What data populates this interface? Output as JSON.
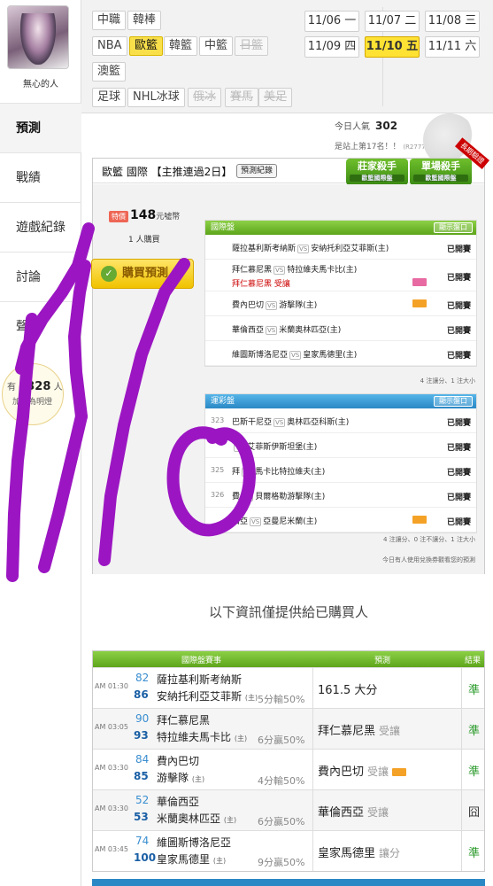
{
  "sidebar": {
    "username": "無心的人",
    "items": [
      {
        "label": "預測",
        "active": true
      },
      {
        "label": "戰績"
      },
      {
        "label": "遊戲紀錄"
      },
      {
        "label": "討論"
      },
      {
        "label": "聲"
      }
    ],
    "likes": {
      "prefix": "有",
      "count": "4328",
      "suffix": "人",
      "sub": "加我為明燈"
    }
  },
  "leagues": [
    {
      "label": "中職"
    },
    {
      "label": "韓棒"
    },
    {
      "label": "NBA"
    },
    {
      "label": "歐籃",
      "selected": true
    },
    {
      "label": "韓籃"
    },
    {
      "label": "中籃"
    },
    {
      "label": "日籃",
      "disabled": true
    },
    {
      "label": "澳籃"
    },
    {
      "label": "足球"
    },
    {
      "label": "NHL冰球"
    },
    {
      "label": "俄冰",
      "disabled": true
    },
    {
      "label": "賽馬",
      "disabled": true
    },
    {
      "label": "美足",
      "disabled": true
    }
  ],
  "dates": [
    {
      "label": "11/06 一"
    },
    {
      "label": "11/07 二"
    },
    {
      "label": "11/08 三"
    },
    {
      "label": "11/09 四"
    },
    {
      "label": "11/10 五",
      "selected": true
    },
    {
      "label": "11/11 六"
    }
  ],
  "stats": {
    "popularity_label": "今日人氣",
    "popularity": "302",
    "rank_text": "是站上第17名！！",
    "rank_code": "(R2777A)"
  },
  "main": {
    "title": "歐籃 國際 【主推連過2日】",
    "record_button": "預測紀錄",
    "badges": [
      {
        "title": "莊家殺手",
        "sub": "歐籃國際盤"
      },
      {
        "title": "單場殺手",
        "sub": "歐籃國際盤"
      }
    ],
    "ribbon": "長期驗證",
    "price_tag": "特價",
    "price": "148",
    "price_unit": "元噓幣",
    "buyers": "1 人購買",
    "buy_button": "購買預測",
    "intl_panel": {
      "title": "國際盤",
      "show_button": "顯示盤口",
      "rows": [
        {
          "home": "薩拉基利斯考納斯",
          "away": "安納托利亞艾菲斯(主)",
          "status": "已開賽"
        },
        {
          "home": "拜仁慕尼黑",
          "away": "特拉維夫馬卡比(主)",
          "pick": "拜仁慕尼黑 受讓",
          "status": "已開賽"
        },
        {
          "home": "費內巴切",
          "away": "游擊隊(主)",
          "status": "已開賽"
        },
        {
          "home": "華倫西亞",
          "away": "米蘭奧林匹亞(主)",
          "status": "已開賽"
        },
        {
          "home": "維圖斯博洛尼亞",
          "away": "皇家馬德里(主)",
          "status": "已開賽"
        }
      ],
      "footer": "4 注讓分、1 注大小"
    },
    "lottery_panel": {
      "title": "運彩盤",
      "show_button": "顯示盤口",
      "rows": [
        {
          "num": "323",
          "home": "巴斯干尼亞",
          "away": "奧林匹亞科斯(主)",
          "status": "已開賽"
        },
        {
          "num": "",
          "home": "",
          "away": "艾菲斯伊斯坦堡(主)",
          "status": "已開賽"
        },
        {
          "num": "325",
          "home": "拜",
          "away": "馬卡比特拉維夫(主)",
          "status": "已開賽"
        },
        {
          "num": "326",
          "home": "費",
          "away": "貝爾格勒游擊隊(主)",
          "status": "已開賽"
        },
        {
          "num": "",
          "home": "西亞",
          "away": "亞曼尼米蘭(主)",
          "status": "已開賽"
        }
      ],
      "footer": "4 注讓分、0 注不讓分、1 注大小"
    },
    "exchange_note": "今日有人使用兌換券觀看您的預測"
  },
  "purchased": {
    "subtitle": "以下資訊僅提供給已購買人",
    "columns": [
      "國際盤賽事",
      "預測",
      "結果"
    ],
    "rows": [
      {
        "time": "AM 01:30",
        "n1": "82",
        "t1": "薩拉基利斯考納斯",
        "n2": "86",
        "t2": "安納托利亞艾菲斯",
        "home_mark": "(主)",
        "odds": "5分輸50%",
        "pick": "161.5 大分",
        "pick_note": "",
        "result": "準"
      },
      {
        "time": "AM 03:05",
        "n1": "90",
        "t1": "拜仁慕尼黑",
        "n2": "93",
        "t2": "特拉維夫馬卡比",
        "home_mark": "(主)",
        "odds": "6分贏50%",
        "pick": "拜仁慕尼黑",
        "pick_note": "受讓",
        "result": "準"
      },
      {
        "time": "AM 03:30",
        "n1": "84",
        "t1": "費內巴切",
        "n2": "85",
        "t2": "游擊隊",
        "home_mark": "(主)",
        "odds": "4分輸50%",
        "pick": "費內巴切",
        "pick_note": "受讓",
        "result": "準"
      },
      {
        "time": "AM 03:30",
        "n1": "52",
        "t1": "華倫西亞",
        "n2": "53",
        "t2": "米蘭奧林匹亞",
        "home_mark": "(主)",
        "odds": "6分贏50%",
        "pick": "華倫西亞",
        "pick_note": "受讓",
        "result": "囧"
      },
      {
        "time": "AM 03:45",
        "n1": "74",
        "t1": "維圖斯博洛尼亞",
        "n2": "100",
        "t2": "皇家馬德里",
        "home_mark": "(主)",
        "odds": "9分贏50%",
        "pick": "皇家馬德里",
        "pick_note": "讓分",
        "result": "準"
      }
    ]
  },
  "colors": {
    "accent_green": "#5da51c",
    "accent_blue": "#2a88c5",
    "selected_yellow": "#ffe233",
    "scribble": "#9b16c2"
  }
}
